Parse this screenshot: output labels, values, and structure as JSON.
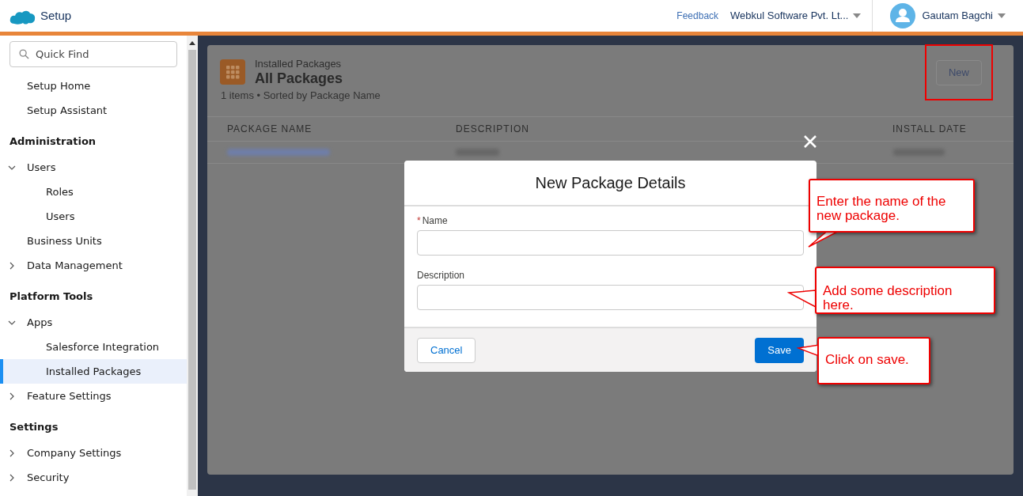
{
  "header": {
    "app_title": "Setup",
    "feedback": "Feedback",
    "org": "Webkul Software Pvt. Lt...",
    "user": "Gautam Bagchi"
  },
  "sidebar": {
    "search": {
      "placeholder": "Quick Find"
    },
    "items": [
      {
        "kind": "link",
        "label": "Setup Home",
        "selected": false
      },
      {
        "kind": "link",
        "label": "Setup Assistant",
        "selected": false
      },
      {
        "kind": "heading",
        "label": "Administration"
      },
      {
        "kind": "group",
        "label": "Users",
        "expanded": true,
        "children": [
          {
            "label": "Roles",
            "selected": false
          },
          {
            "label": "Users",
            "selected": false
          }
        ]
      },
      {
        "kind": "link",
        "label": "Business Units",
        "selected": false
      },
      {
        "kind": "group",
        "label": "Data Management",
        "expanded": false
      },
      {
        "kind": "heading",
        "label": "Platform Tools"
      },
      {
        "kind": "group",
        "label": "Apps",
        "expanded": true,
        "children": [
          {
            "label": "Salesforce Integration",
            "selected": false
          },
          {
            "label": "Installed Packages",
            "selected": true
          }
        ]
      },
      {
        "kind": "group",
        "label": "Feature Settings",
        "expanded": false
      },
      {
        "kind": "heading",
        "label": "Settings"
      },
      {
        "kind": "group",
        "label": "Company Settings",
        "expanded": false
      },
      {
        "kind": "group",
        "label": "Security",
        "expanded": false
      }
    ]
  },
  "page": {
    "eyebrow": "Installed Packages",
    "title": "All Packages",
    "summary": "1 items • Sorted by Package Name",
    "new_button": "New",
    "columns": [
      "PACKAGE NAME",
      "DESCRIPTION",
      "INSTALL DATE"
    ]
  },
  "modal": {
    "title": "New Package Details",
    "fields": [
      {
        "marker": "*",
        "label": "Name"
      },
      {
        "label": "Description"
      }
    ],
    "cancel": "Cancel",
    "save": "Save"
  },
  "callouts": [
    "Enter the name of the new package.",
    "Add some description here.",
    "Click on save."
  ]
}
